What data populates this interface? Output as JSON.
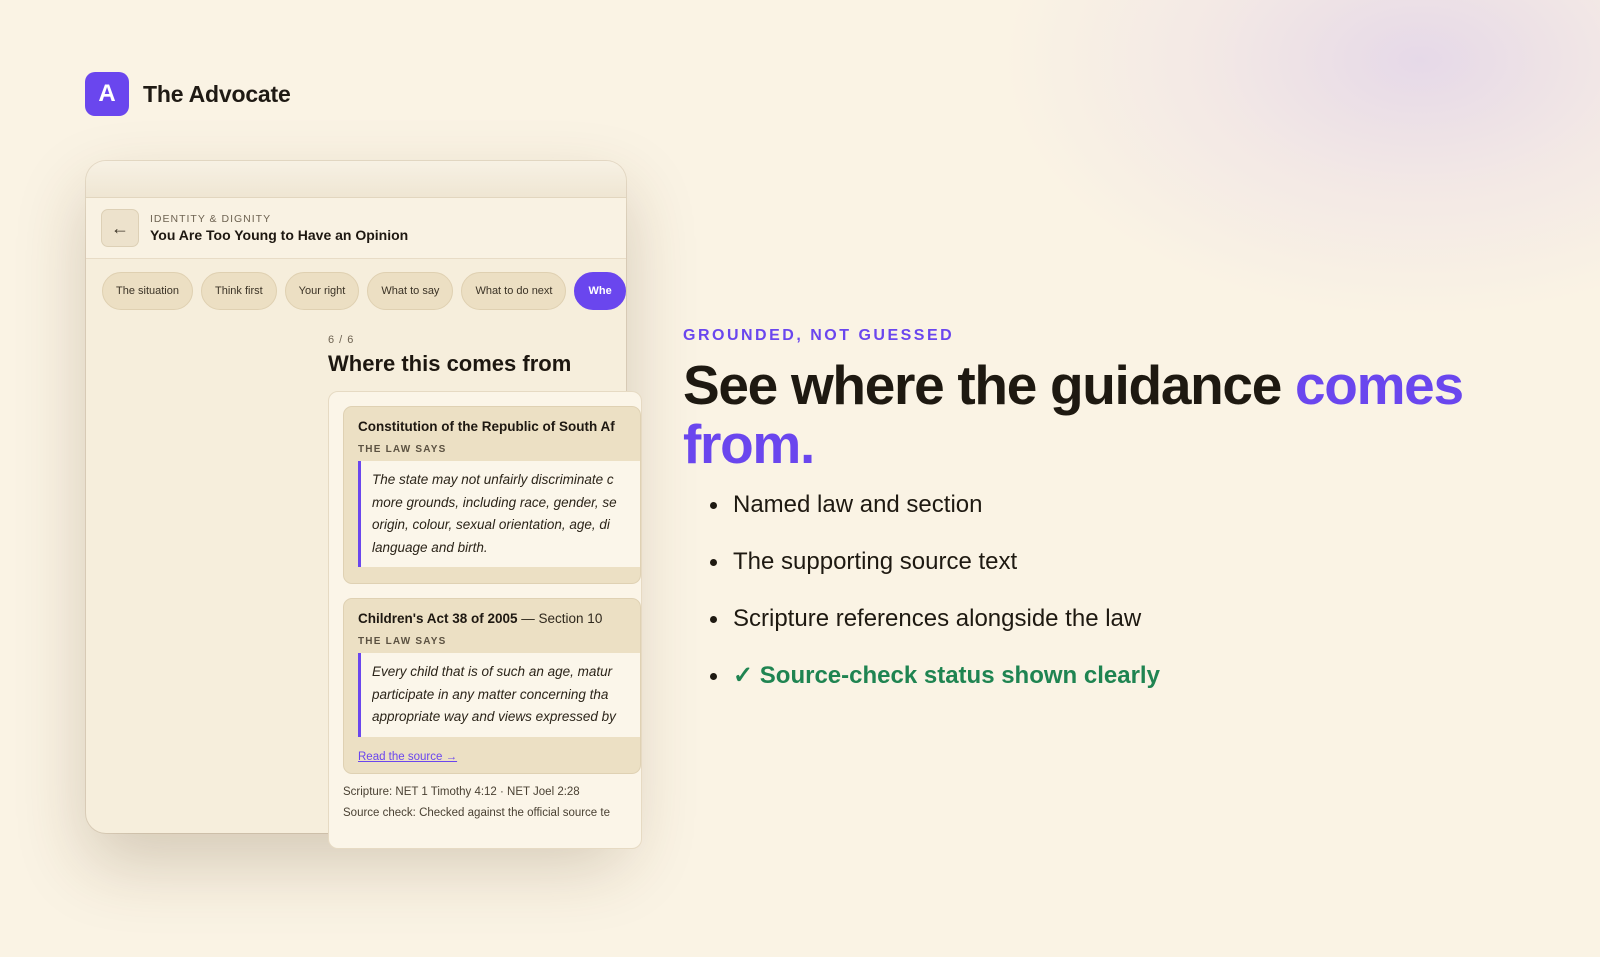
{
  "brand": {
    "mark": "A",
    "name": "The Advocate"
  },
  "app": {
    "header": {
      "back_icon": "←",
      "category": "IDENTITY & DIGNITY",
      "title": "You Are Too Young to Have an Opinion"
    },
    "tabs": [
      {
        "label": "The situation",
        "active": false
      },
      {
        "label": "Think first",
        "active": false
      },
      {
        "label": "Your right",
        "active": false
      },
      {
        "label": "What to say",
        "active": false
      },
      {
        "label": "What to do next",
        "active": false
      },
      {
        "label": "Whe",
        "active": true
      }
    ],
    "step": "6 / 6",
    "section_title": "Where this comes from",
    "sources": [
      {
        "name": "Constitution of the Republic of South Af",
        "section": "",
        "label": "THE LAW SAYS",
        "quote_lines": [
          "The state may not unfairly discriminate c",
          "more grounds, including race, gender, se",
          "origin, colour, sexual orientation, age, di",
          "language and birth."
        ],
        "link": ""
      },
      {
        "name": "Children's Act 38 of 2005",
        "section": "— Section 10",
        "label": "THE LAW SAYS",
        "quote_lines": [
          "Every child that is of such an age, matur",
          "participate in any matter concerning tha",
          "appropriate way and views expressed by"
        ],
        "link": "Read the source →"
      }
    ],
    "scripture": "Scripture: NET 1 Timothy 4:12 · NET Joel 2:28",
    "source_check": "Source check: Checked against the official source te"
  },
  "marketing": {
    "eyebrow": "GROUNDED, NOT GUESSED",
    "headline_main": "See where the guidance ",
    "headline_accent": "comes from.",
    "bullets": [
      "Named law and section",
      "The supporting source text",
      "Scripture references alongside the law",
      "✓ Source-check status shown clearly"
    ]
  },
  "colors": {
    "accent": "#6a46ee",
    "success": "#1f8451",
    "background": "#faf3e4"
  }
}
